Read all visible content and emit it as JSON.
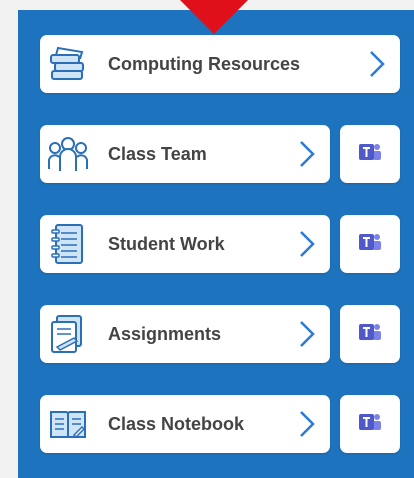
{
  "colors": {
    "panel_blue": "#1e73be",
    "accent_red": "#e0101a",
    "chevron_blue": "#2a7ad6",
    "teams_purple": "#5059c9",
    "label_gray": "#444444"
  },
  "items": [
    {
      "label": "Computing Resources",
      "icon": "books-stack-icon",
      "has_teams": false
    },
    {
      "label": "Class Team",
      "icon": "people-group-icon",
      "has_teams": true
    },
    {
      "label": "Student Work",
      "icon": "notebook-icon",
      "has_teams": true
    },
    {
      "label": "Assignments",
      "icon": "assignment-document-icon",
      "has_teams": true
    },
    {
      "label": "Class Notebook",
      "icon": "open-book-icon",
      "has_teams": true
    }
  ],
  "teams_icon": "microsoft-teams-icon",
  "pointer_icon": "red-arrow-pointer-icon"
}
